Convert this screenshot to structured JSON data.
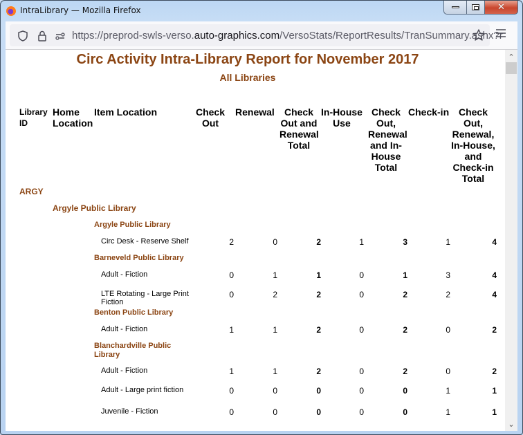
{
  "window": {
    "title": "IntraLibrary — Mozilla Firefox",
    "controls": {
      "minimize": "minimize",
      "maximize": "maximize",
      "close": "✕"
    }
  },
  "browser": {
    "url_prefix": "https://preprod-swls-verso.",
    "url_host": "auto-graphics.com",
    "url_path": "/VersoStats/ReportResults/TranSummary.ashx?r",
    "icons": [
      "shield-icon",
      "lock-icon",
      "permissions-icon",
      "bookmark-star-icon",
      "menu-icon"
    ]
  },
  "report": {
    "title": "Circ Activity Intra-Library Report for November 2017",
    "subtitle": "All Libraries",
    "colors": {
      "heading": "#8b4513",
      "text": "#000000"
    },
    "columns": {
      "library_id": [
        "Library",
        "ID"
      ],
      "home_location": [
        "Home",
        "Location"
      ],
      "item_location": [
        "Item Location"
      ],
      "check_out": [
        "Check",
        "Out"
      ],
      "renewal": [
        "Renewal"
      ],
      "co_renewal_total": [
        "Check",
        "Out and",
        "Renewal",
        "Total"
      ],
      "in_house": [
        "In-House",
        "Use"
      ],
      "co_ren_ih_total": [
        "Check",
        "Out,",
        "Renewal",
        "and In-",
        "House",
        "Total"
      ],
      "check_in": [
        "Check-in"
      ],
      "grand_total": [
        "Check",
        "Out,",
        "Renewal,",
        "In-House,",
        "and",
        "Check-in",
        "Total"
      ]
    },
    "library_id": "ARGY",
    "home_location": "Argyle Public Library",
    "groups": [
      {
        "item_library": "Argyle Public Library",
        "rows": [
          {
            "location": "Circ Desk - Reserve Shelf",
            "values": [
              2,
              0,
              2,
              1,
              3,
              1,
              4
            ]
          }
        ]
      },
      {
        "item_library": "Barneveld Public Library",
        "rows": [
          {
            "location": "Adult - Fiction",
            "values": [
              0,
              1,
              1,
              0,
              1,
              3,
              4
            ]
          },
          {
            "location": "LTE Rotating - Large Print Fiction",
            "values": [
              0,
              2,
              2,
              0,
              2,
              2,
              4
            ]
          }
        ]
      },
      {
        "item_library": "Benton Public Library",
        "rows": [
          {
            "location": "Adult - Fiction",
            "values": [
              1,
              1,
              2,
              0,
              2,
              0,
              2
            ]
          }
        ]
      },
      {
        "item_library": "Blanchardville Public Library",
        "rows": [
          {
            "location": "Adult - Fiction",
            "values": [
              1,
              1,
              2,
              0,
              2,
              0,
              2
            ]
          },
          {
            "location": "Adult - Large print fiction",
            "values": [
              0,
              0,
              0,
              0,
              0,
              1,
              1
            ]
          },
          {
            "location": "Juvenile - Fiction",
            "values": [
              0,
              0,
              0,
              0,
              0,
              1,
              1
            ]
          }
        ]
      }
    ]
  }
}
